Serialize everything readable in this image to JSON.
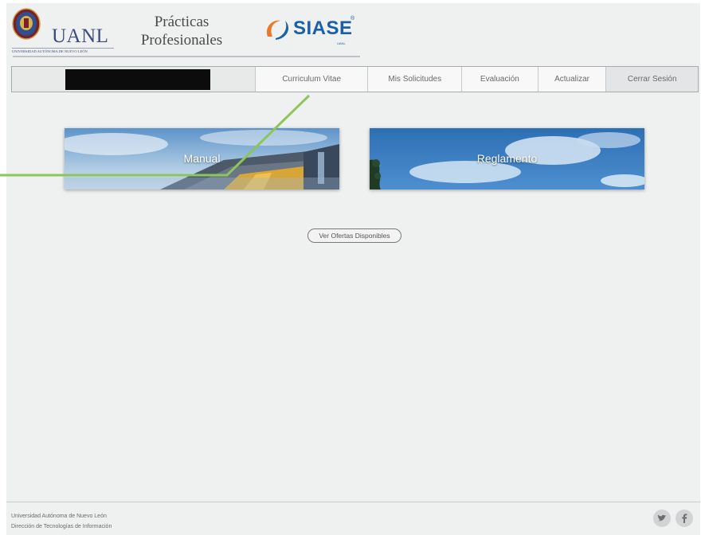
{
  "header": {
    "uanl_logo_text": "UANL",
    "uanl_logo_subtext": "UNIVERSIDAD AUTÓNOMA DE NUEVO LEÓN",
    "title_line1": "Prácticas",
    "title_line2": "Profesionales",
    "siase_logo_text": "SIASE",
    "siase_registered": "®",
    "siase_subtext": "UANL"
  },
  "nav": {
    "items": [
      {
        "label": "Curriculum Vitae"
      },
      {
        "label": "Mis Solicitudes"
      },
      {
        "label": "Evaluación"
      },
      {
        "label": "Actualizar"
      },
      {
        "label": "Cerrar Sesión"
      }
    ]
  },
  "cards": {
    "manual": {
      "label": "Manual"
    },
    "reglamento": {
      "label": "Reglamento"
    }
  },
  "offers_button": {
    "label": "Ver Ofertas Disponibles"
  },
  "footer": {
    "line1": "Universidad Autónoma de Nuevo León",
    "line2": "Dirección de Tecnologías de Información"
  },
  "social": {
    "twitter_icon": "twitter-icon",
    "facebook_icon": "facebook-icon"
  },
  "colors": {
    "background": "#eff0f0",
    "siase_blue": "#1a5fa8",
    "uanl_blue": "#3b4d7a",
    "annotation_line": "#8cc65a"
  }
}
